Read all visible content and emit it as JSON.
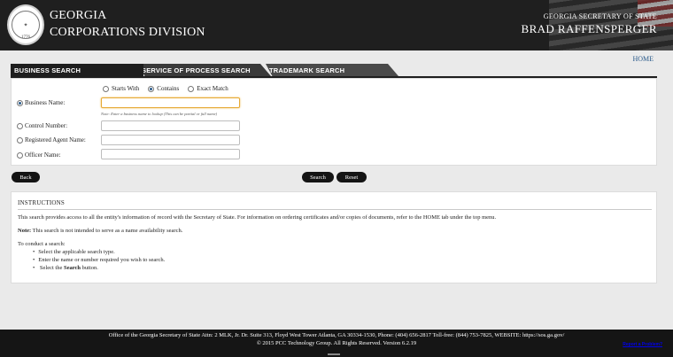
{
  "header": {
    "seal_year": "1776",
    "brand_line1": "GEORGIA",
    "brand_line2": "CORPORATIONS DIVISION",
    "office_line1": "GEORGIA SECRETARY OF STATE",
    "office_line2": "BRAD RAFFENSPERGER"
  },
  "nav": {
    "home_label": "HOME"
  },
  "tabs": [
    {
      "label": "BUSINESS SEARCH",
      "active": true
    },
    {
      "label": "SERVICE OF PROCESS SEARCH",
      "active": false
    },
    {
      "label": "TRADEMARK SEARCH",
      "active": false
    }
  ],
  "search_form": {
    "match_options": [
      {
        "label": "Starts With",
        "selected": false
      },
      {
        "label": "Contains",
        "selected": true
      },
      {
        "label": "Exact Match",
        "selected": false
      }
    ],
    "fields": [
      {
        "label": "Business Name:",
        "selected": true,
        "value": ""
      },
      {
        "label": "Control Number:",
        "selected": false,
        "value": ""
      },
      {
        "label": "Registered Agent Name:",
        "selected": false,
        "value": ""
      },
      {
        "label": "Officer Name:",
        "selected": false,
        "value": ""
      }
    ],
    "business_note": "Note: Enter a business name to lookup (This can be partial or full name)"
  },
  "buttons": {
    "back": "Back",
    "search": "Search",
    "reset": "Reset"
  },
  "instructions": {
    "title": "INSTRUCTIONS",
    "paragraph1": "This search provides access to all the entity's information of record with the Secretary of State. For information on ordering certificates and/or copies of documents, refer to the HOME tab under the top menu.",
    "note_label": "Note:",
    "note_text": " This search is not intended to serve as a name availability search.",
    "steps_intro": "To conduct a search:",
    "step1": "Select the applicable search type.",
    "step2": "Enter the name or number required you wish to search.",
    "step3_prefix": "Select the ",
    "step3_bold": "Search",
    "step3_suffix": " button."
  },
  "footer": {
    "line1": "Office of the Georgia Secretary of State Attn: 2 MLK, Jr. Dr. Suite 313, Floyd West Tower Atlanta, GA 30334-1530, Phone: (404) 656-2817 Toll-free: (844) 753-7825, WEBSITE: https://sos.ga.gov/",
    "line2": "© 2015 PCC Technology Group. All Rights Reserved. Version 6.2.19",
    "report_link": "Report a Problem?"
  }
}
